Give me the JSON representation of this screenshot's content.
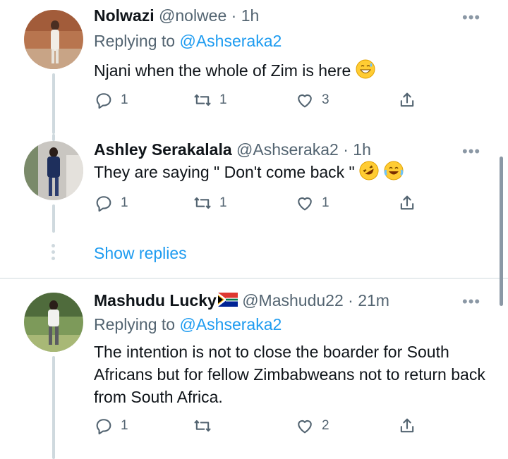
{
  "tweets": [
    {
      "name": "Nolwazi",
      "handle": "@nolwee",
      "time": "· 1h",
      "replying_prefix": "Replying to ",
      "replying_to": "@Ashseraka2",
      "text": "Njani when the whole of Zim is here",
      "emoji": [
        "sweat-smile-icon"
      ],
      "replies": "1",
      "retweets": "1",
      "likes": "3"
    },
    {
      "name": "Ashley Serakalala",
      "handle": "@Ashseraka2",
      "time": "· 1h",
      "text": "They are saying \" Don't come back \"",
      "emoji": [
        "rofl-icon",
        "joy-icon"
      ],
      "replies": "1",
      "retweets": "1",
      "likes": "1"
    },
    {
      "name": "Mashudu Lucky",
      "flag": "south-africa-flag-icon",
      "handle": "@Mashudu22",
      "time": "· 21m",
      "replying_prefix": "Replying to ",
      "replying_to": "@Ashseraka2",
      "text": "The intention is not to close the boarder for South Africans but for fellow Zimbabweans not to return back from South Africa.",
      "replies": "1",
      "retweets": "",
      "likes": "2"
    }
  ],
  "show_replies": "Show replies",
  "colors": {
    "accent": "#1d9bf0",
    "text": "#0f1419",
    "secondary": "#536471",
    "line": "#cfd9de"
  }
}
